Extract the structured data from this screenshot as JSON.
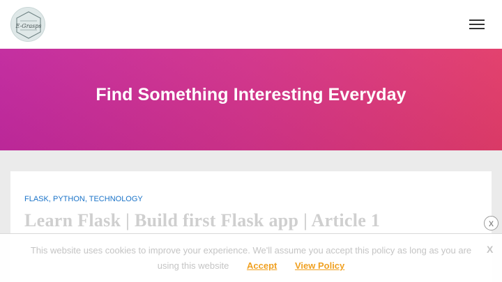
{
  "logo": {
    "text": "E-Grasps"
  },
  "hero": {
    "title": "Find Something Interesting Everyday"
  },
  "post": {
    "categories": [
      "FLASK",
      "PYTHON",
      "TECHNOLOGY"
    ],
    "title": "Learn Flask | Build first Flask app | Article 1"
  },
  "cookie": {
    "message_line1": "This website uses cookies to improve your experience. We'll assume you accept this policy as long as you are",
    "message_line2": "using this website",
    "accept_label": "Accept",
    "policy_label": "View Policy",
    "close_label": "X",
    "close_top_label": "x"
  },
  "colors": {
    "hero_gradient_start": "#c2299e",
    "hero_gradient_end": "#e23c6a",
    "category_link": "#1a73c8",
    "cookie_link": "#f0a020"
  },
  "icons": {
    "menu": "hamburger-menu-icon",
    "logo": "site-logo"
  }
}
